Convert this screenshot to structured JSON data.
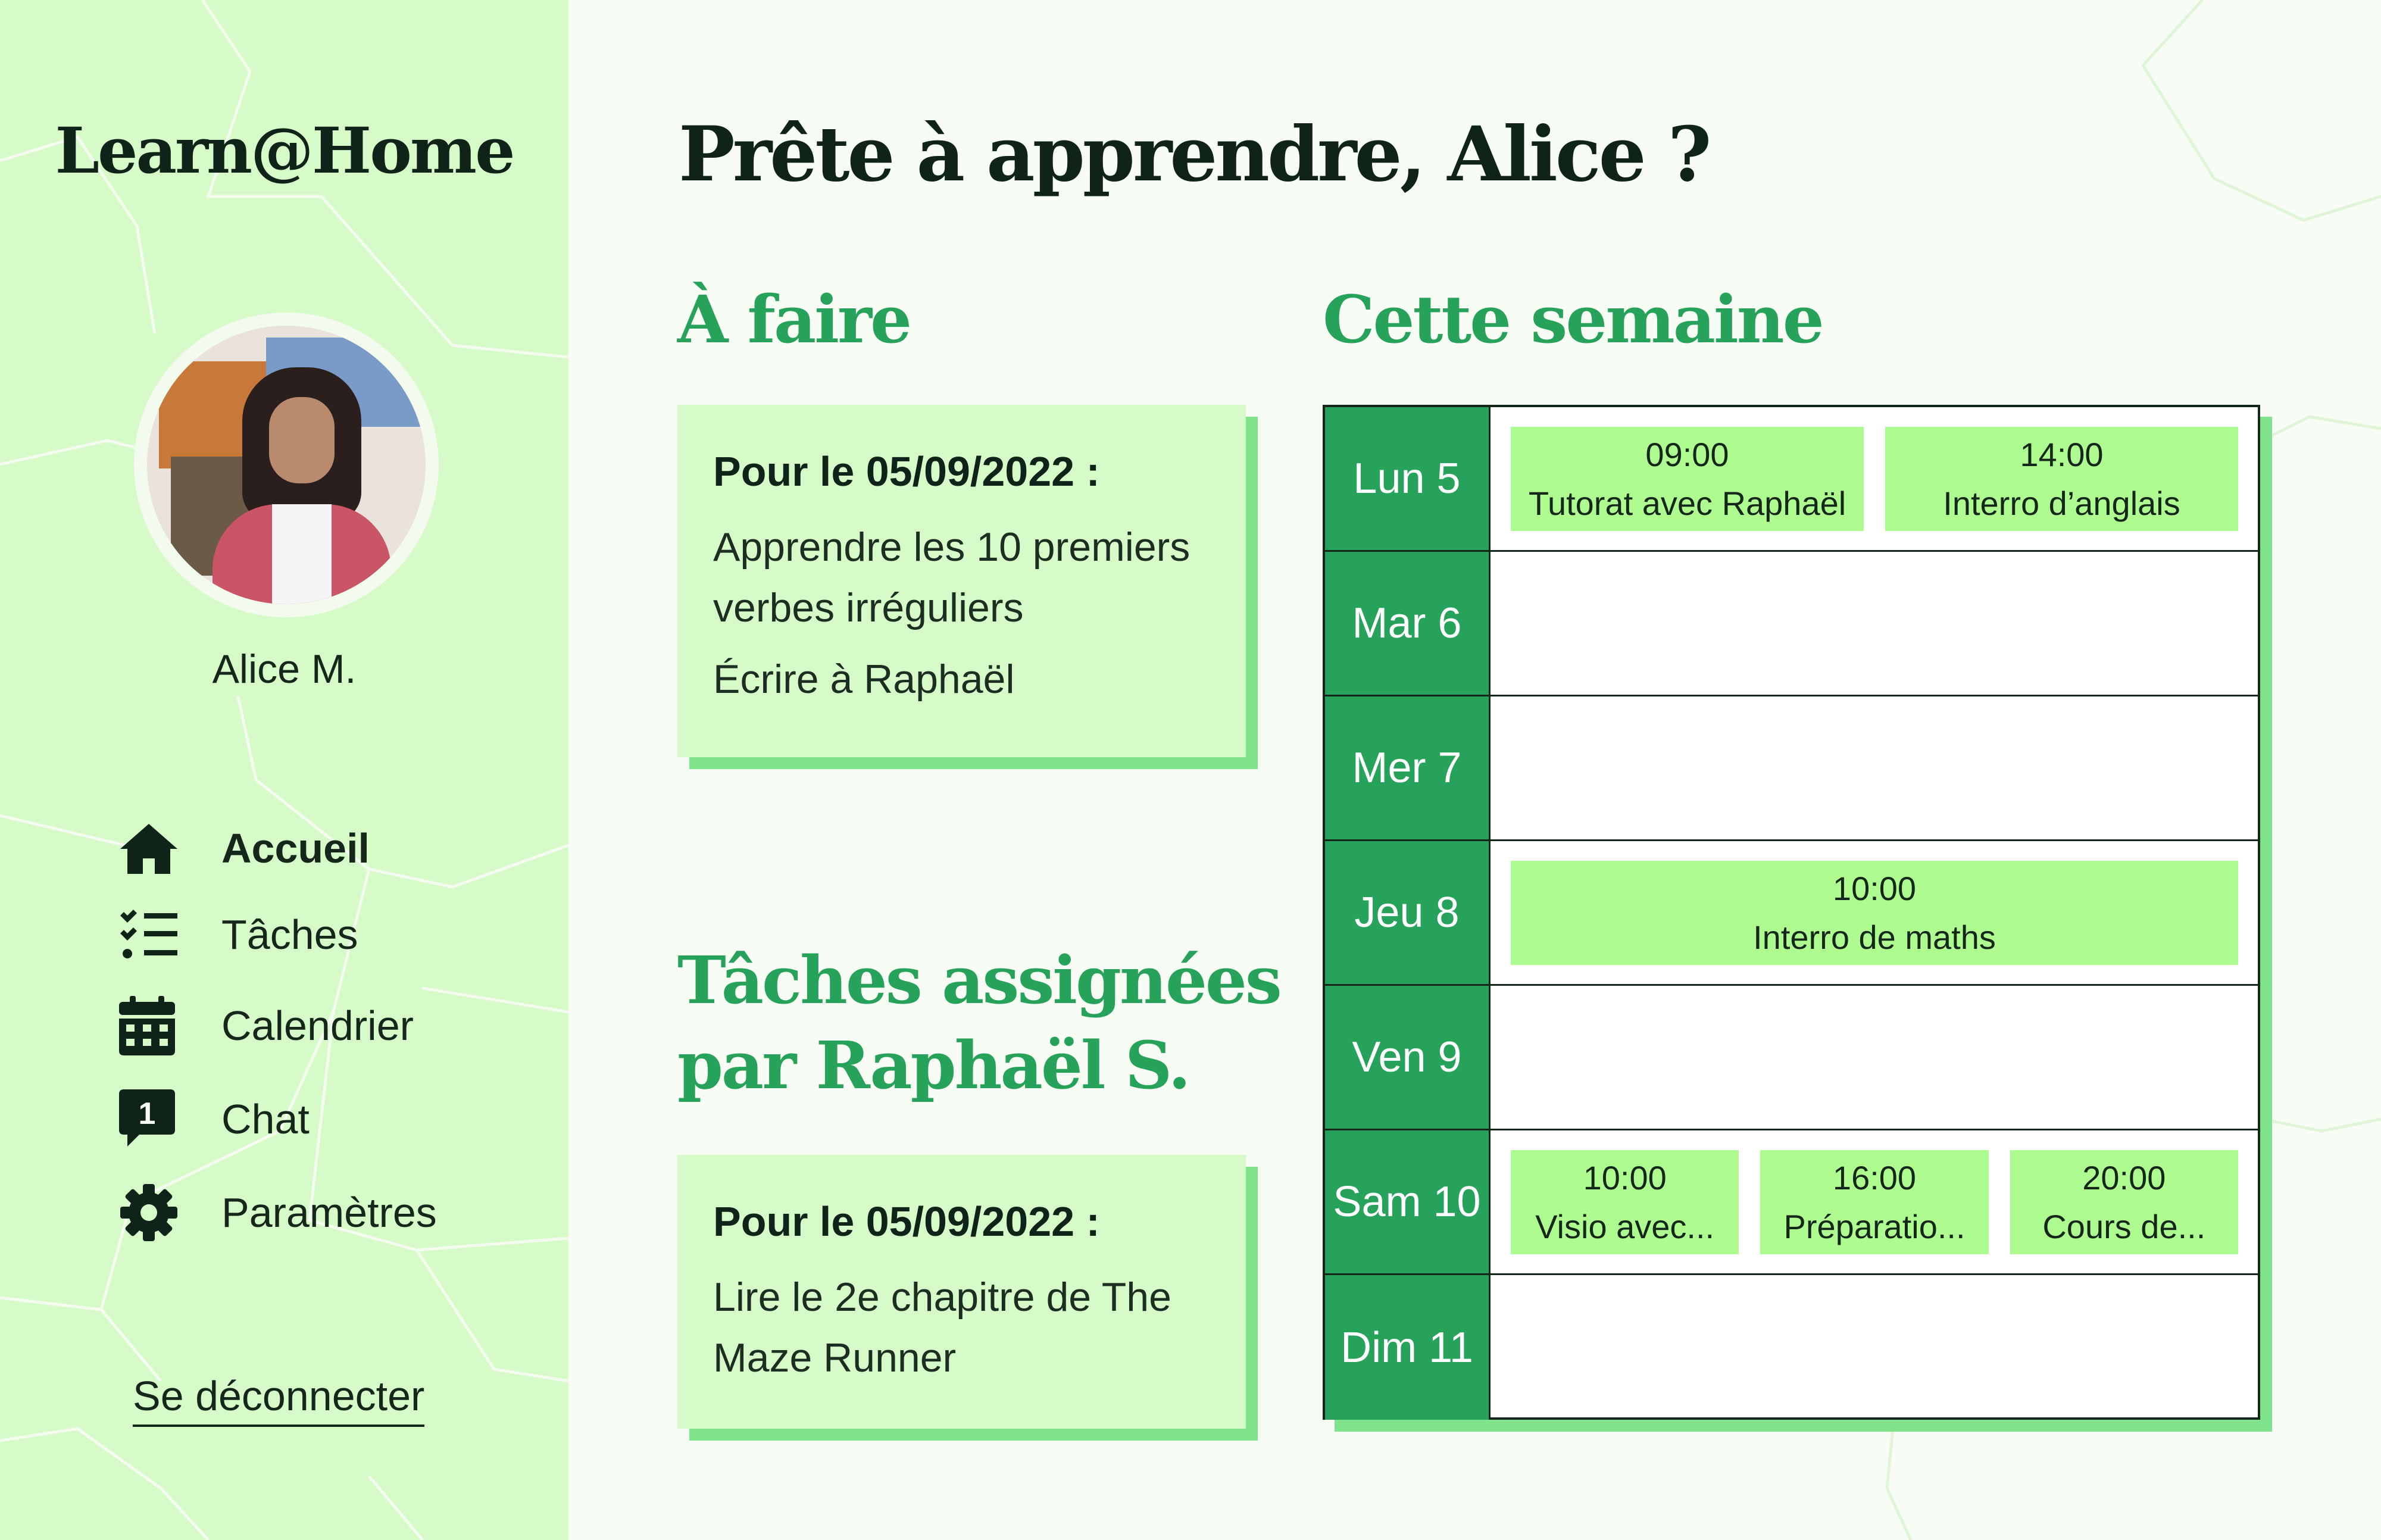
{
  "app": {
    "brand": "Learn@Home"
  },
  "user": {
    "name": "Alice M."
  },
  "greeting": "Prête à apprendre, Alice ?",
  "nav": [
    {
      "label": "Accueil",
      "icon": "home-icon",
      "active": true
    },
    {
      "label": "Tâches",
      "icon": "checklist-icon",
      "active": false
    },
    {
      "label": "Calendrier",
      "icon": "calendar-icon",
      "active": false
    },
    {
      "label": "Chat",
      "icon": "chat-icon",
      "badge": "1",
      "active": false
    },
    {
      "label": "Paramètres",
      "icon": "gear-icon",
      "active": false
    }
  ],
  "logout_label": "Se déconnecter",
  "todo": {
    "title": "À faire",
    "due": "Pour le 05/09/2022 :",
    "tasks": [
      "Apprendre les 10 premiers verbes irréguliers",
      "Écrire à Raphaël"
    ]
  },
  "assigned": {
    "title_line1": "Tâches assignées",
    "title_line2": "par Raphaël S.",
    "due": "Pour le 05/09/2022 :",
    "tasks": [
      "Lire le 2e chapitre de The Maze Runner"
    ]
  },
  "week": {
    "title": "Cette semaine",
    "days": [
      {
        "label": "Lun 5",
        "events": [
          {
            "time": "09:00",
            "title": "Tutorat avec Raphaël"
          },
          {
            "time": "14:00",
            "title": "Interro d’anglais"
          }
        ]
      },
      {
        "label": "Mar 6",
        "events": []
      },
      {
        "label": "Mer 7",
        "events": []
      },
      {
        "label": "Jeu 8",
        "events": [
          {
            "time": "10:00",
            "title": "Interro de maths"
          }
        ]
      },
      {
        "label": "Ven 9",
        "events": []
      },
      {
        "label": "Sam 10",
        "events": [
          {
            "time": "10:00",
            "title": "Visio avec..."
          },
          {
            "time": "16:00",
            "title": "Préparatio..."
          },
          {
            "time": "20:00",
            "title": "Cours de..."
          }
        ]
      },
      {
        "label": "Dim 11",
        "events": []
      }
    ]
  },
  "colors": {
    "sidebar_bg": "#d6fac8",
    "accent": "#27a25a",
    "event_bg": "#aefb8f",
    "shadow": "#7fe38b"
  }
}
